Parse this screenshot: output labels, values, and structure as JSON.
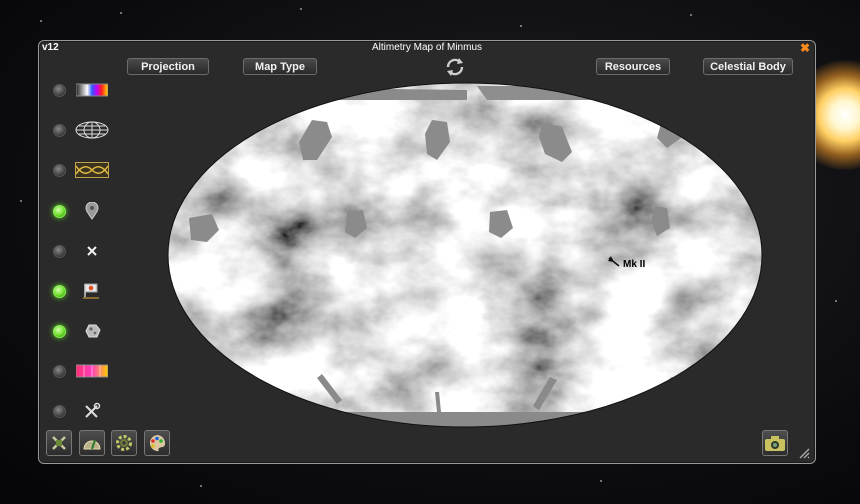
{
  "window": {
    "version": "v12",
    "title": "Altimetry Map of Minmus",
    "close_glyph": "✖"
  },
  "toolbar": {
    "projection_label": "Projection",
    "map_type_label": "Map Type",
    "resources_label": "Resources",
    "celestial_body_label": "Celestial Body",
    "refresh_icon": "refresh-icon"
  },
  "sidebar": {
    "items": [
      {
        "name": "color-scale-toggle",
        "icon": "color-gradient-icon",
        "enabled": false
      },
      {
        "name": "grid-toggle",
        "icon": "globe-grid-icon",
        "enabled": false
      },
      {
        "name": "ground-track-toggle",
        "icon": "orbit-track-icon",
        "enabled": false
      },
      {
        "name": "waypoint-toggle",
        "icon": "map-pin-icon",
        "enabled": true
      },
      {
        "name": "anomaly-toggle",
        "icon": "x-mark-icon",
        "enabled": false
      },
      {
        "name": "flag-toggle",
        "icon": "flag-icon",
        "enabled": true
      },
      {
        "name": "asteroid-toggle",
        "icon": "asteroid-icon",
        "enabled": true
      },
      {
        "name": "resource-overlay-toggle",
        "icon": "resource-gradient-icon",
        "enabled": false
      },
      {
        "name": "tools-toggle",
        "icon": "tools-icon",
        "enabled": false
      }
    ]
  },
  "bottom_bar": {
    "left_icons": [
      "satellite-icon",
      "altimeter-icon",
      "settings-gear-icon",
      "color-palette-icon"
    ],
    "right_icon": "camera-icon"
  },
  "map": {
    "vessel_label": "Mk II",
    "vessel_icon": "vessel-marker-icon"
  },
  "colors": {
    "accent_orange": "#ff8a1a",
    "toggle_on": "#6ce02b",
    "panel_bg": "#2a2a2a"
  }
}
